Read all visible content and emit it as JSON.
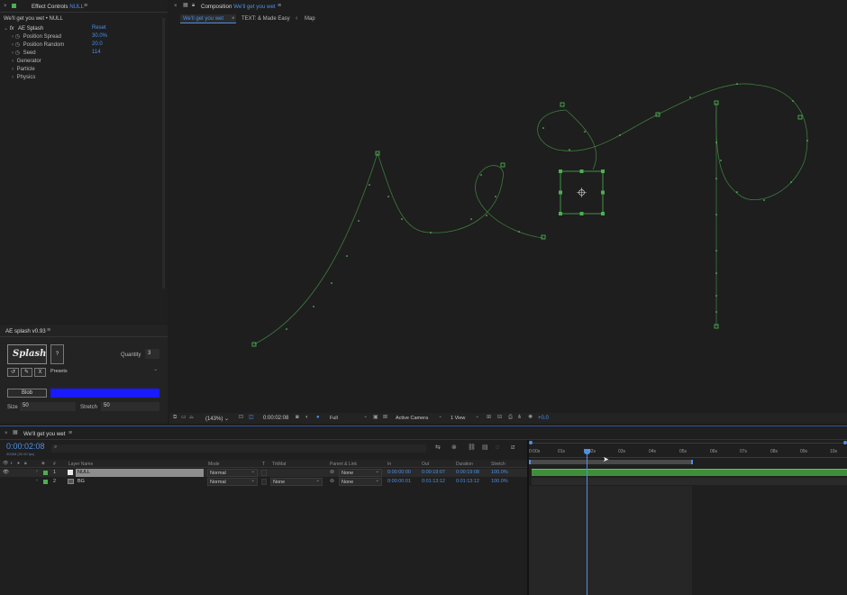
{
  "effect_controls": {
    "tab_title_prefix": "Effect Controls",
    "tab_layer": "NULL",
    "subtitle": "We'll get you wet • NULL",
    "effect_name": "AE Splash",
    "reset_label": "Reset",
    "properties": [
      {
        "label": "Position Spread",
        "value": "30.0%"
      },
      {
        "label": "Position Random",
        "value": "20.0"
      },
      {
        "label": "Seed",
        "value": "114"
      }
    ],
    "groups": [
      "Generator",
      "Particle",
      "Physics"
    ]
  },
  "ae_splash_panel": {
    "title": "AE splash v0.93",
    "logo_text": "Splash",
    "help_label": "?",
    "quantity_label": "Quantity",
    "quantity_value": "3",
    "tool_buttons": [
      "↺",
      "✎",
      "X"
    ],
    "presets_label": "Presets",
    "blob_label": "Blob",
    "blob_color": "#1a1aff",
    "size_label": "Size",
    "size_value": "50",
    "stretch_label": "Stretch",
    "stretch_value": "50"
  },
  "composition": {
    "tab_title_prefix": "Composition",
    "tab_comp": "We'll get you wet",
    "tabs": [
      "We'll get you wet",
      "TEXT: & Made Easy",
      "Map"
    ],
    "footer": {
      "zoom": "(143%)",
      "timecode": "0:00:02:08",
      "resolution": "Full",
      "camera": "Active Camera",
      "view": "1 View",
      "exposure": "+0.0"
    }
  },
  "timeline": {
    "tab_title": "We'll get you wet",
    "timecode": "0:00:02:08",
    "timecode_sub": "00068 (30.00 fps)",
    "search_placeholder": "",
    "columns": {
      "num": "#",
      "layer_name": "Layer Name",
      "mode": "Mode",
      "t": "T",
      "trkmat": "TrkMat",
      "parent": "Parent & Link",
      "in": "In",
      "out": "Out",
      "duration": "Duration",
      "stretch": "Stretch"
    },
    "layers": [
      {
        "num": "1",
        "name": "NULL",
        "color": "#4caf50",
        "mode": "Normal",
        "trkmat": "",
        "parent": "None",
        "in": "0:00:00:00",
        "out": "0:00:19:07",
        "duration": "0:00:19:08",
        "stretch": "100.0%"
      },
      {
        "num": "2",
        "name": "BG",
        "color": "#4caf50",
        "mode": "Normal",
        "trkmat": "None",
        "parent": "None",
        "in": "0:00:00:01",
        "out": "0:01:13:12",
        "duration": "0:01:13:12",
        "stretch": "100.0%"
      }
    ],
    "ruler": [
      "0:00s",
      "01s",
      "02s",
      "03s",
      "04s",
      "05s",
      "06s",
      "07s",
      "08s",
      "09s",
      "10s"
    ]
  }
}
